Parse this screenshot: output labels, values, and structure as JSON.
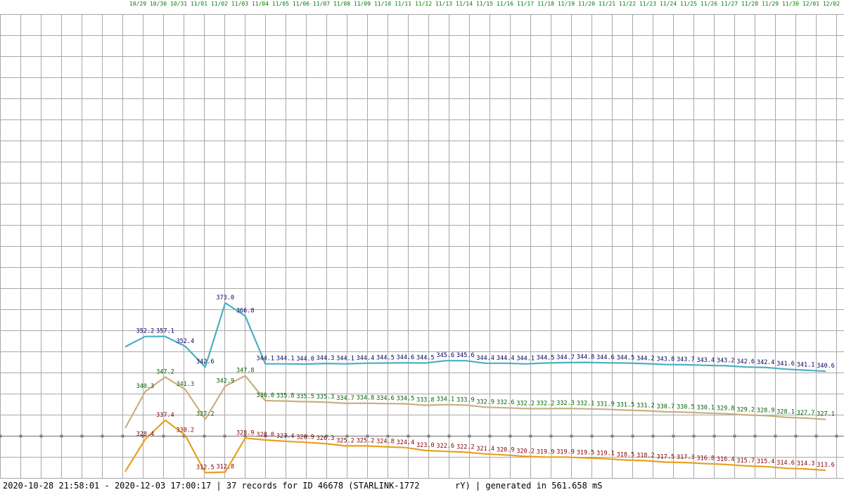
{
  "footer": {
    "text": "2020-10-28 21:58:01 - 2020-12-03 17:00:17 | 37 records for ID 46678 (STARLINK-1772       rY) | generated in 561.658 mS"
  },
  "colors": {
    "grid": "#a8a8a8",
    "tick_text": "#008000",
    "apogee": "#4ab0c0",
    "mean": "#c8b080",
    "perigee": "#e8a020",
    "apogee_label": "#000060",
    "mean_label": "#006000",
    "perigee_label": "#800000"
  },
  "chart_data": {
    "type": "line",
    "x": [
      "10/29",
      "10/30",
      "10/31",
      "11/01",
      "11/02",
      "11/03",
      "11/04",
      "11/05",
      "11/06",
      "11/07",
      "11/08",
      "11/09",
      "11/10",
      "11/11",
      "11/12",
      "11/13",
      "11/14",
      "11/15",
      "11/16",
      "11/17",
      "11/18",
      "11/19",
      "11/20",
      "11/21",
      "11/22",
      "11/23",
      "11/24",
      "11/25",
      "11/26",
      "11/27",
      "11/28",
      "11/29",
      "11/30",
      "12/01",
      "12/02"
    ],
    "ylim": [
      300,
      400
    ],
    "grid": true,
    "series": [
      {
        "key": "apogee",
        "values": [
          352.2,
          357.1,
          357.1,
          352.4,
          342.6,
          373.0,
          366.8,
          344.1,
          344.1,
          344.0,
          344.3,
          344.1,
          344.4,
          344.5,
          344.6,
          344.5,
          345.6,
          345.6,
          344.4,
          344.4,
          344.1,
          344.5,
          344.7,
          344.8,
          344.6,
          344.5,
          344.2,
          343.8,
          343.7,
          343.4,
          343.2,
          342.6,
          342.4,
          341.6,
          341.1,
          340.6
        ],
        "labels": [
          "352.2",
          "357.1",
          "352.4",
          "342.6",
          "373.0",
          "366.8",
          "344.1",
          "344.1",
          "344.0",
          "344.3",
          "344.1",
          "344.4",
          "344.5",
          "344.6",
          "344.5",
          "345.6",
          "345.6",
          "344.4",
          "344.4",
          "344.1",
          "344.5",
          "344.7",
          "344.8",
          "344.6",
          "344.5",
          "344.2",
          "343.8",
          "343.7",
          "343.4",
          "343.2",
          "342.6",
          "342.4",
          "341.6",
          "341.1",
          "340.6"
        ]
      },
      {
        "key": "mean",
        "labels": [
          "340.3",
          "347.2",
          "341.3",
          "327.2",
          "342.9",
          "347.8",
          "336.0",
          "335.8",
          "335.5",
          "335.3",
          "334.7",
          "334.8",
          "334.6",
          "334.5",
          "333.8",
          "334.1",
          "333.9",
          "332.9",
          "332.6",
          "332.2",
          "332.2",
          "332.3",
          "332.1",
          "331.9",
          "331.5",
          "331.2",
          "330.7",
          "330.5",
          "330.1",
          "329.8",
          "329.2",
          "328.9",
          "328.1",
          "327.7",
          "327.1"
        ]
      },
      {
        "key": "perigee",
        "labels": [
          "328.4",
          "337.4",
          "330.2",
          "312.5",
          "312.8",
          "328.9",
          "328.0",
          "327.4",
          "326.9",
          "326.3",
          "325.2",
          "325.2",
          "324.8",
          "324.4",
          "323.0",
          "322.6",
          "322.2",
          "321.4",
          "320.9",
          "320.2",
          "319.9",
          "319.9",
          "319.5",
          "319.1",
          "318.5",
          "318.2",
          "317.5",
          "317.3",
          "316.8",
          "316.4",
          "315.7",
          "315.4",
          "314.6",
          "314.3",
          "313.6"
        ]
      }
    ]
  }
}
